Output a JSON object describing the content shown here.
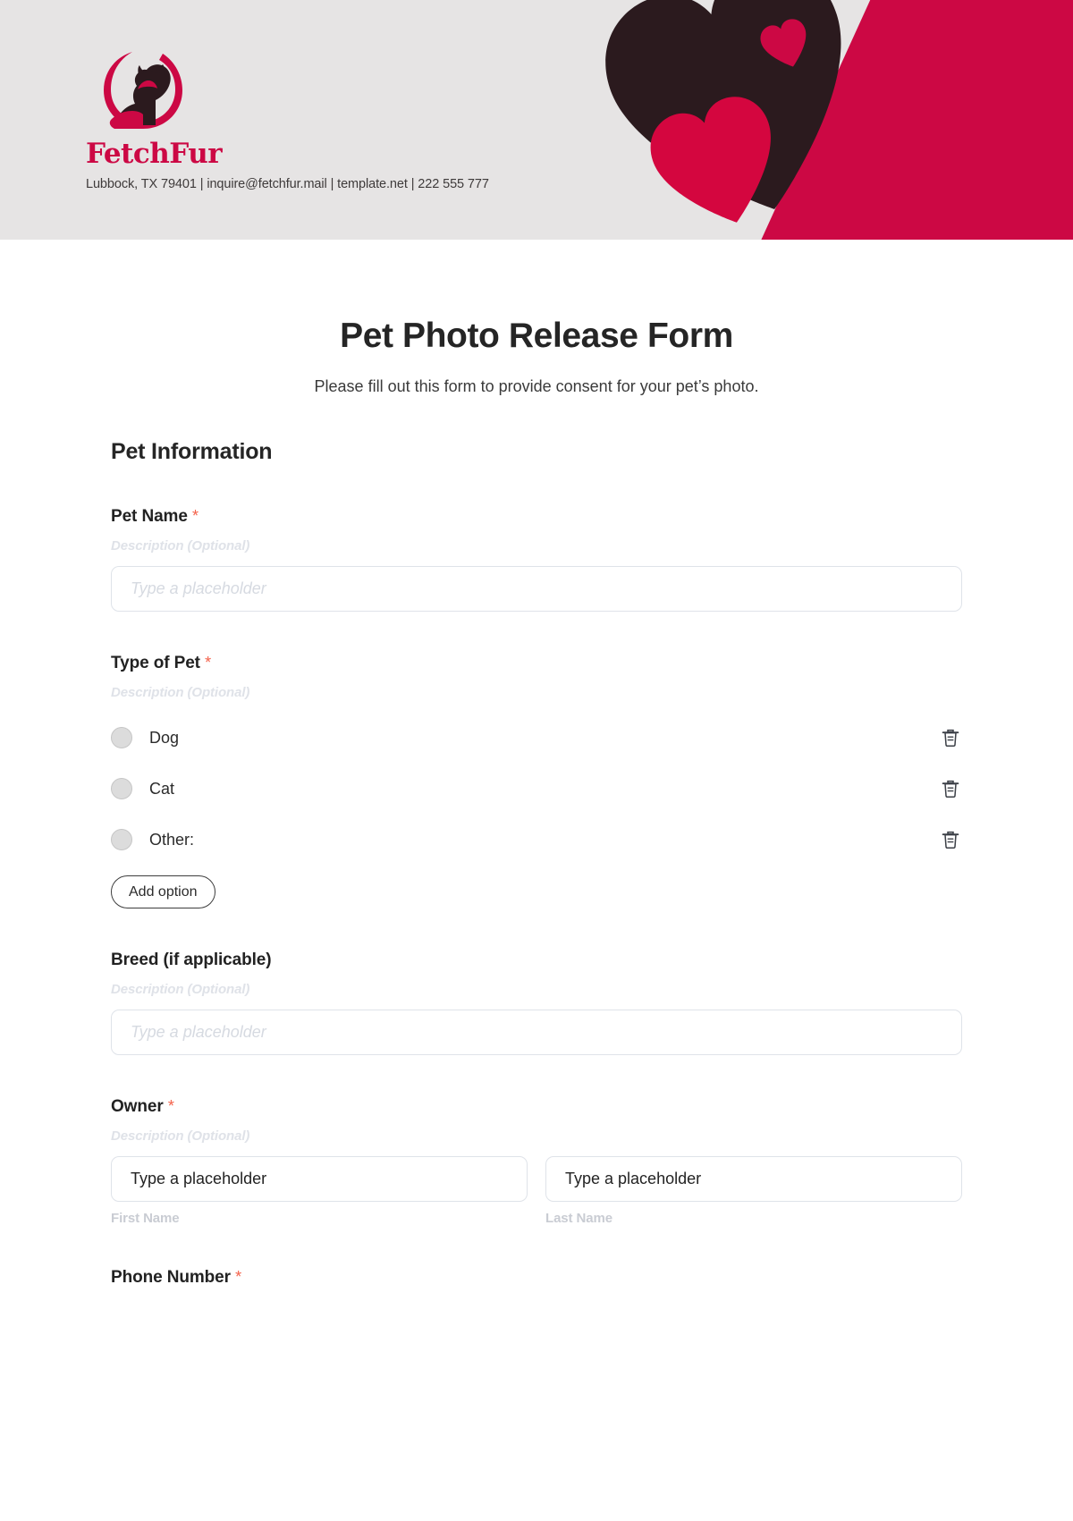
{
  "header": {
    "brand_name": "FetchFur",
    "contact": "Lubbock, TX 79401 | inquire@fetchfur.mail | template.net | 222 555 777",
    "colors": {
      "band_background": "#E6E4E4",
      "crimson": "#CC0844",
      "dark_heart": "#2B1A1E"
    },
    "logo_icon": "dog-cat-circle-logo",
    "decor_icons": [
      "dark-heart",
      "small-crimson-heart",
      "crimson-heart"
    ]
  },
  "form": {
    "title": "Pet Photo Release Form",
    "subtitle": "Please fill out this form to provide consent for your pet’s photo.",
    "section_heading": "Pet Information",
    "required_marker": "*",
    "description_placeholder": "Description (Optional)",
    "input_placeholder": "Type a placeholder",
    "add_option_label": "Add option",
    "fields": [
      {
        "label": "Pet Name",
        "required": true,
        "type": "text",
        "description": "Description (Optional)",
        "placeholder": "Type a placeholder"
      },
      {
        "label": "Type of Pet",
        "required": true,
        "type": "radio",
        "description": "Description (Optional)",
        "options": [
          "Dog",
          "Cat",
          "Other:"
        ]
      },
      {
        "label": "Breed (if applicable)",
        "required": false,
        "type": "text",
        "description": "Description (Optional)",
        "placeholder": "Type a placeholder"
      },
      {
        "label": "Owner",
        "required": true,
        "type": "name",
        "description": "Description (Optional)",
        "first_placeholder": "Type a placeholder",
        "last_placeholder": "Type a placeholder",
        "first_sub_label": "First Name",
        "last_sub_label": "Last Name"
      },
      {
        "label": "Phone Number",
        "required": true,
        "type": "text"
      }
    ]
  }
}
